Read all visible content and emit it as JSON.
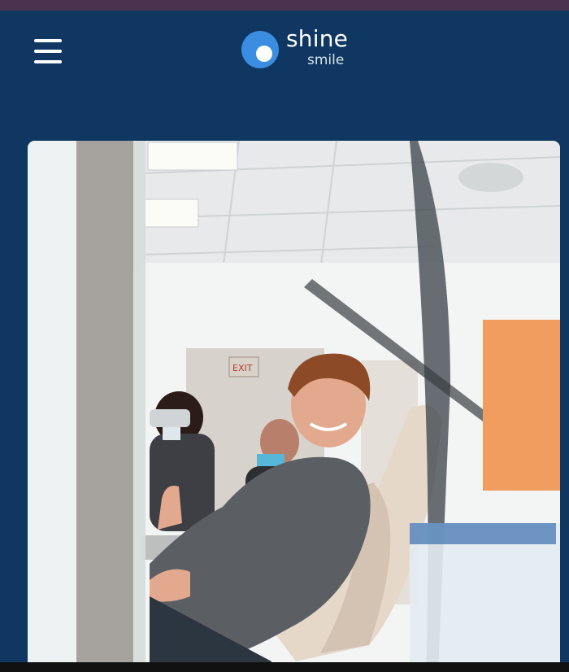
{
  "header": {
    "menu_icon": "hamburger-menu-icon",
    "logo": {
      "word1": "shine",
      "word2": "smile",
      "mark_color": "#3a8de0"
    }
  },
  "hero": {
    "image_alt": "Smiling boy in dental chair giving thumbs up",
    "exit_sign": "EXIT"
  },
  "colors": {
    "page_background": "#0f3761",
    "top_strip": "#4b3350",
    "accent_blue": "#3a8de0"
  }
}
